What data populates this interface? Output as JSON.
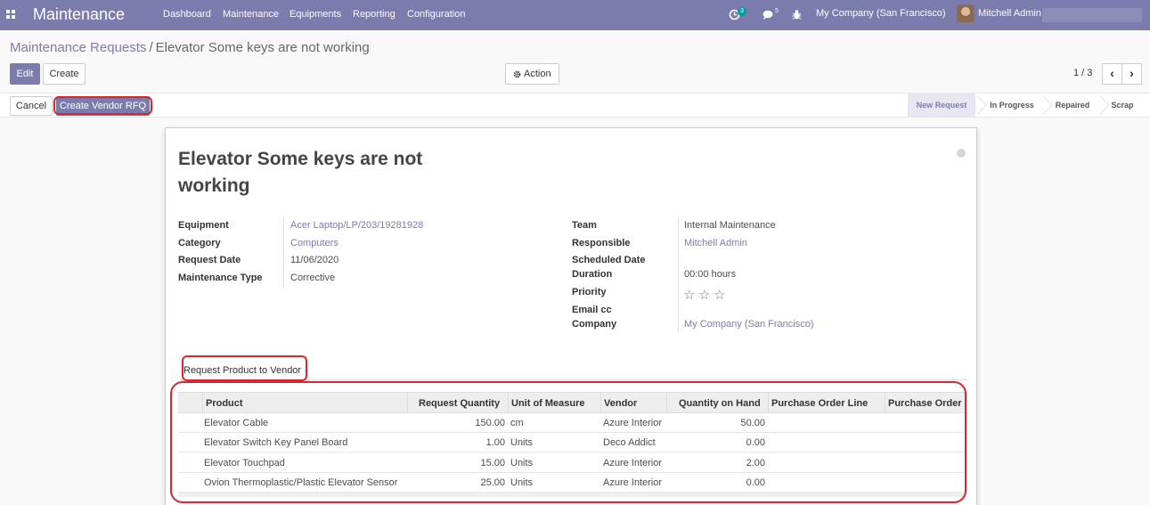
{
  "navbar": {
    "brand": "Maintenance",
    "menu": [
      "Dashboard",
      "Maintenance",
      "Equipments",
      "Reporting",
      "Configuration"
    ],
    "activity_count": "3",
    "message_count": "5",
    "company": "My Company (San Francisco)",
    "user": "Mitchell Admin",
    "icons": [
      "apps-icon",
      "activity-icon",
      "chat-icon",
      "bug-icon",
      "avatar"
    ]
  },
  "breadcrumb": {
    "parent": "Maintenance Requests",
    "separator": "/",
    "current": "Elevator Some keys are not working"
  },
  "controls": {
    "edit_label": "Edit",
    "create_label": "Create",
    "action_label": "Action",
    "action_icon": "gear-icon",
    "pager": "1 / 3",
    "prev_icon": "chevron-left-icon",
    "next_icon": "chevron-right-icon"
  },
  "statusbar": {
    "cancel_label": "Cancel",
    "vendor_rfq_label": "Create Vendor RFQ",
    "stages": [
      "New Request",
      "In Progress",
      "Repaired",
      "Scrap"
    ],
    "active_stage": "New Request"
  },
  "form": {
    "title_line1": "Elevator Some keys are not",
    "title_line2": "working",
    "left_fields": [
      {
        "label": "Equipment",
        "value": "Acer Laptop/LP/203/19281928",
        "link": true
      },
      {
        "label": "Category",
        "value": "Computers",
        "link": true
      },
      {
        "label": "Request Date",
        "value": "11/06/2020",
        "link": false
      },
      {
        "label": "Maintenance Type",
        "value": "Corrective",
        "link": false
      }
    ],
    "right_fields": [
      {
        "label": "Team",
        "value": "Internal Maintenance",
        "link": false
      },
      {
        "label": "Responsible",
        "value": "Mitchell Admin",
        "link": true
      },
      {
        "label": "Scheduled Date",
        "value": "",
        "link": false
      },
      {
        "label": "Duration",
        "value": "00:00  hours",
        "link": false
      },
      {
        "label": "Priority",
        "value": "",
        "link": false
      },
      {
        "label": "Email cc",
        "value": "",
        "link": false
      },
      {
        "label": "Company",
        "value": "My Company (San Francisco)",
        "link": true
      }
    ],
    "priority_stars": 0,
    "priority_max": 3,
    "tab_label": "Request Product to Vendor"
  },
  "table": {
    "headers": [
      "Product",
      "Request Quantity",
      "Unit of Measure",
      "Vendor",
      "Quantity on Hand",
      "Purchase Order Line",
      "Purchase Order"
    ],
    "rows": [
      {
        "product": "Elevator Cable",
        "qty": "150.00",
        "uom": "cm",
        "vendor": "Azure Interior",
        "on_hand": "50.00",
        "pol": "",
        "po": ""
      },
      {
        "product": "Elevator Switch Key Panel Board",
        "qty": "1.00",
        "uom": "Units",
        "vendor": "Deco Addict",
        "on_hand": "0.00",
        "pol": "",
        "po": ""
      },
      {
        "product": "Elevator Touchpad",
        "qty": "15.00",
        "uom": "Units",
        "vendor": "Azure Interior",
        "on_hand": "2.00",
        "pol": "",
        "po": ""
      },
      {
        "product": "Ovion Thermoplastic/Plastic Elevator Sensor",
        "qty": "25.00",
        "uom": "Units",
        "vendor": "Azure Interior",
        "on_hand": "0.00",
        "pol": "",
        "po": ""
      }
    ]
  },
  "colors": {
    "brand": "#7c7bad",
    "highlight": "#d9262e",
    "badge": "#00a09d"
  }
}
